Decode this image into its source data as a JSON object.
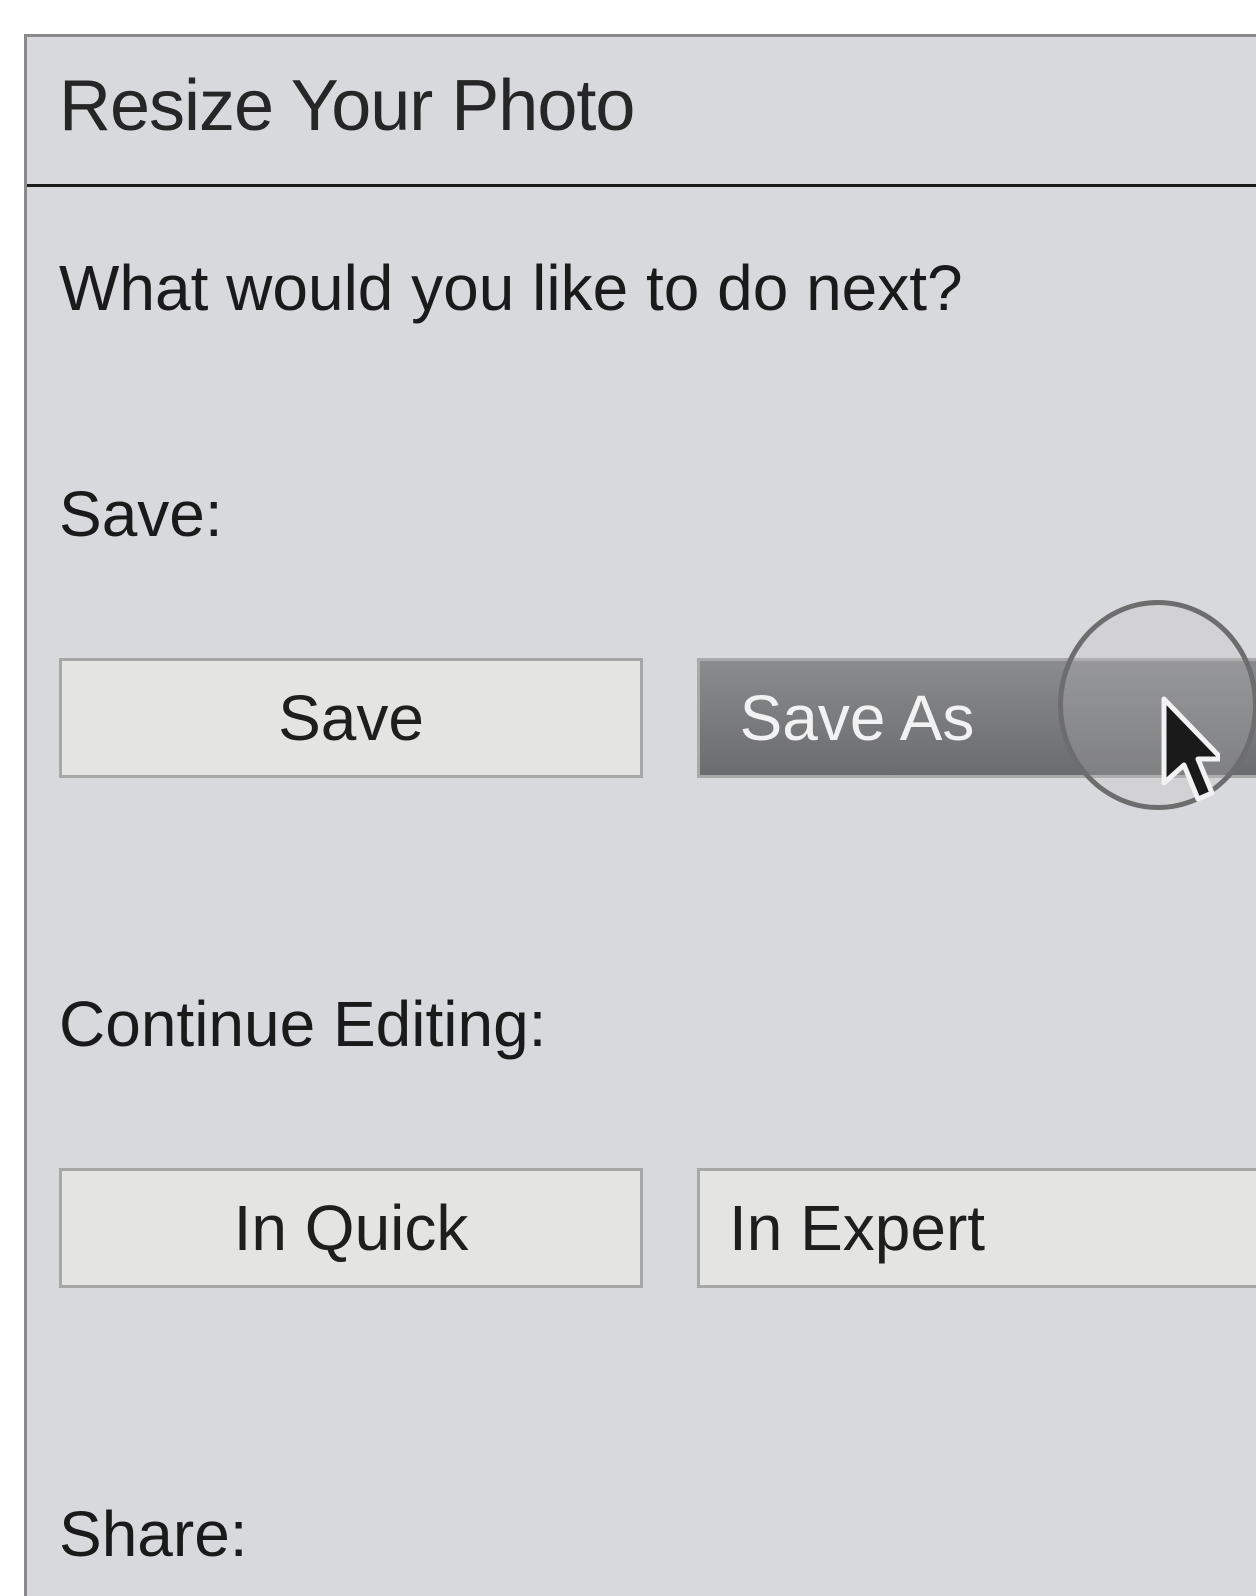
{
  "panel": {
    "title": "Resize Your Photo",
    "prompt": "What would you like to do next?"
  },
  "sections": {
    "save": {
      "label": "Save:",
      "buttons": {
        "save": "Save",
        "save_as": "Save As"
      }
    },
    "continue_editing": {
      "label": "Continue Editing:",
      "buttons": {
        "quick": "In Quick",
        "expert": "In Expert"
      }
    },
    "share": {
      "label": "Share:"
    }
  },
  "cursor": {
    "icon": "arrow-pointer-icon",
    "highlight": "click-ring"
  },
  "colors": {
    "panel_bg": "#d8d9dc",
    "button_bg": "#e4e4e2",
    "active_button_bg": "#7b7c7e"
  }
}
